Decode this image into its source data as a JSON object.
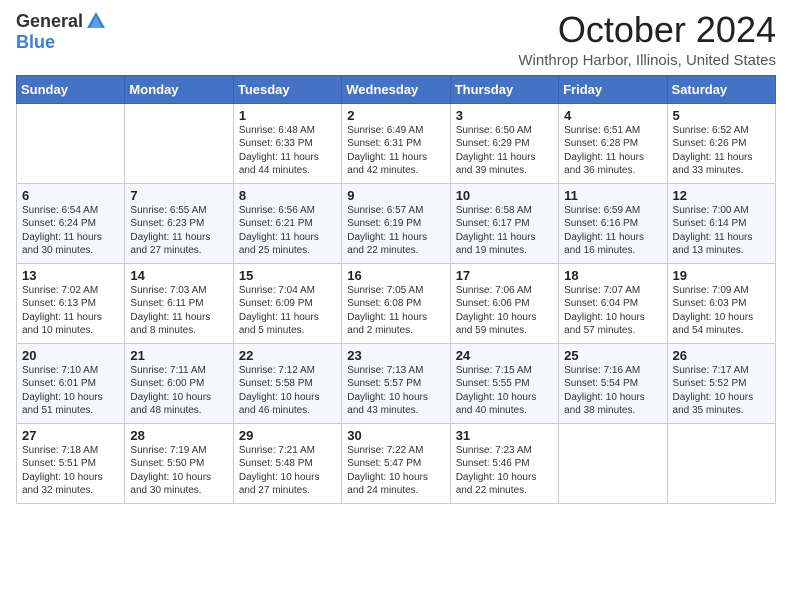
{
  "logo": {
    "general": "General",
    "blue": "Blue"
  },
  "title": "October 2024",
  "location": "Winthrop Harbor, Illinois, United States",
  "weekdays": [
    "Sunday",
    "Monday",
    "Tuesday",
    "Wednesday",
    "Thursday",
    "Friday",
    "Saturday"
  ],
  "weeks": [
    [
      {
        "day": "",
        "info": ""
      },
      {
        "day": "",
        "info": ""
      },
      {
        "day": "1",
        "info": "Sunrise: 6:48 AM\nSunset: 6:33 PM\nDaylight: 11 hours and 44 minutes."
      },
      {
        "day": "2",
        "info": "Sunrise: 6:49 AM\nSunset: 6:31 PM\nDaylight: 11 hours and 42 minutes."
      },
      {
        "day": "3",
        "info": "Sunrise: 6:50 AM\nSunset: 6:29 PM\nDaylight: 11 hours and 39 minutes."
      },
      {
        "day": "4",
        "info": "Sunrise: 6:51 AM\nSunset: 6:28 PM\nDaylight: 11 hours and 36 minutes."
      },
      {
        "day": "5",
        "info": "Sunrise: 6:52 AM\nSunset: 6:26 PM\nDaylight: 11 hours and 33 minutes."
      }
    ],
    [
      {
        "day": "6",
        "info": "Sunrise: 6:54 AM\nSunset: 6:24 PM\nDaylight: 11 hours and 30 minutes."
      },
      {
        "day": "7",
        "info": "Sunrise: 6:55 AM\nSunset: 6:23 PM\nDaylight: 11 hours and 27 minutes."
      },
      {
        "day": "8",
        "info": "Sunrise: 6:56 AM\nSunset: 6:21 PM\nDaylight: 11 hours and 25 minutes."
      },
      {
        "day": "9",
        "info": "Sunrise: 6:57 AM\nSunset: 6:19 PM\nDaylight: 11 hours and 22 minutes."
      },
      {
        "day": "10",
        "info": "Sunrise: 6:58 AM\nSunset: 6:17 PM\nDaylight: 11 hours and 19 minutes."
      },
      {
        "day": "11",
        "info": "Sunrise: 6:59 AM\nSunset: 6:16 PM\nDaylight: 11 hours and 16 minutes."
      },
      {
        "day": "12",
        "info": "Sunrise: 7:00 AM\nSunset: 6:14 PM\nDaylight: 11 hours and 13 minutes."
      }
    ],
    [
      {
        "day": "13",
        "info": "Sunrise: 7:02 AM\nSunset: 6:13 PM\nDaylight: 11 hours and 10 minutes."
      },
      {
        "day": "14",
        "info": "Sunrise: 7:03 AM\nSunset: 6:11 PM\nDaylight: 11 hours and 8 minutes."
      },
      {
        "day": "15",
        "info": "Sunrise: 7:04 AM\nSunset: 6:09 PM\nDaylight: 11 hours and 5 minutes."
      },
      {
        "day": "16",
        "info": "Sunrise: 7:05 AM\nSunset: 6:08 PM\nDaylight: 11 hours and 2 minutes."
      },
      {
        "day": "17",
        "info": "Sunrise: 7:06 AM\nSunset: 6:06 PM\nDaylight: 10 hours and 59 minutes."
      },
      {
        "day": "18",
        "info": "Sunrise: 7:07 AM\nSunset: 6:04 PM\nDaylight: 10 hours and 57 minutes."
      },
      {
        "day": "19",
        "info": "Sunrise: 7:09 AM\nSunset: 6:03 PM\nDaylight: 10 hours and 54 minutes."
      }
    ],
    [
      {
        "day": "20",
        "info": "Sunrise: 7:10 AM\nSunset: 6:01 PM\nDaylight: 10 hours and 51 minutes."
      },
      {
        "day": "21",
        "info": "Sunrise: 7:11 AM\nSunset: 6:00 PM\nDaylight: 10 hours and 48 minutes."
      },
      {
        "day": "22",
        "info": "Sunrise: 7:12 AM\nSunset: 5:58 PM\nDaylight: 10 hours and 46 minutes."
      },
      {
        "day": "23",
        "info": "Sunrise: 7:13 AM\nSunset: 5:57 PM\nDaylight: 10 hours and 43 minutes."
      },
      {
        "day": "24",
        "info": "Sunrise: 7:15 AM\nSunset: 5:55 PM\nDaylight: 10 hours and 40 minutes."
      },
      {
        "day": "25",
        "info": "Sunrise: 7:16 AM\nSunset: 5:54 PM\nDaylight: 10 hours and 38 minutes."
      },
      {
        "day": "26",
        "info": "Sunrise: 7:17 AM\nSunset: 5:52 PM\nDaylight: 10 hours and 35 minutes."
      }
    ],
    [
      {
        "day": "27",
        "info": "Sunrise: 7:18 AM\nSunset: 5:51 PM\nDaylight: 10 hours and 32 minutes."
      },
      {
        "day": "28",
        "info": "Sunrise: 7:19 AM\nSunset: 5:50 PM\nDaylight: 10 hours and 30 minutes."
      },
      {
        "day": "29",
        "info": "Sunrise: 7:21 AM\nSunset: 5:48 PM\nDaylight: 10 hours and 27 minutes."
      },
      {
        "day": "30",
        "info": "Sunrise: 7:22 AM\nSunset: 5:47 PM\nDaylight: 10 hours and 24 minutes."
      },
      {
        "day": "31",
        "info": "Sunrise: 7:23 AM\nSunset: 5:46 PM\nDaylight: 10 hours and 22 minutes."
      },
      {
        "day": "",
        "info": ""
      },
      {
        "day": "",
        "info": ""
      }
    ]
  ]
}
